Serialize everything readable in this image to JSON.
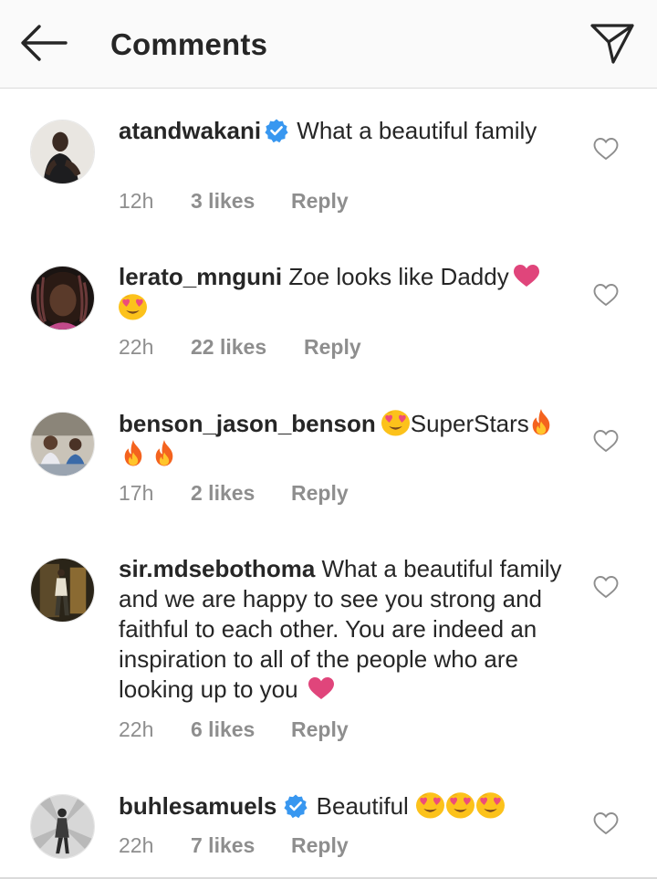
{
  "header": {
    "title": "Comments",
    "back_icon": "arrow-left-icon",
    "send_icon": "paper-plane-icon"
  },
  "colors": {
    "text": "#262626",
    "secondary": "#8e8e8e",
    "verified": "#3897f0",
    "heart": "#e0457b"
  },
  "comments": [
    {
      "username": "atandwakani",
      "verified": true,
      "text": "What a  beautiful family",
      "time": "12h",
      "likes": "3 likes",
      "reply": "Reply"
    },
    {
      "username": "lerato_mnguni",
      "verified": false,
      "text": "Zoe looks like Daddy",
      "emoji": [
        "heart",
        "heart-eyes"
      ],
      "time": "22h",
      "likes": "22 likes",
      "reply": "Reply"
    },
    {
      "username": "benson_jason_benson",
      "verified": false,
      "text": "SuperStars",
      "emoji": [
        "heart-eyes",
        "fire",
        "fire",
        "fire"
      ],
      "time": "17h",
      "likes": "2 likes",
      "reply": "Reply"
    },
    {
      "username": "sir.mdsebothoma",
      "verified": false,
      "text": "What a beautiful family and we are happy to see you strong and faithful to each other. You are indeed an inspiration to all of the people who are looking up to you",
      "emoji": [
        "heart"
      ],
      "time": "22h",
      "likes": "6 likes",
      "reply": "Reply"
    },
    {
      "username": "buhlesamuels",
      "verified": true,
      "text": "Beautiful",
      "emoji": [
        "heart-eyes",
        "heart-eyes",
        "heart-eyes"
      ],
      "time": "22h",
      "likes": "7 likes",
      "reply": "Reply"
    }
  ]
}
